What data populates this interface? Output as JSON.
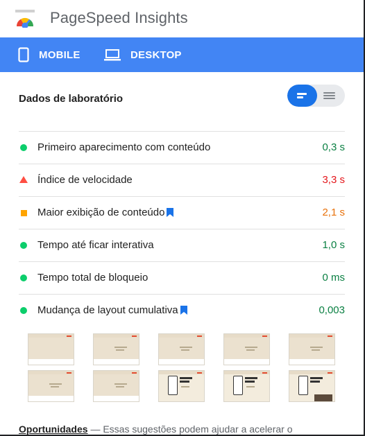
{
  "header": {
    "title": "PageSpeed Insights",
    "logo_icon": "pagespeed-gauge-icon"
  },
  "tabs": [
    {
      "label": "MOBILE",
      "icon": "smartphone-icon"
    },
    {
      "label": "DESKTOP",
      "icon": "laptop-icon"
    }
  ],
  "lab": {
    "title": "Dados de laboratório",
    "metrics": [
      {
        "label": "Primeiro aparecimento com conteúdo",
        "value": "0,3 s",
        "status": "good",
        "bookmark": false
      },
      {
        "label": "Índice de velocidade",
        "value": "3,3 s",
        "status": "poor",
        "bookmark": false
      },
      {
        "label": "Maior exibição de conteúdo",
        "value": "2,1 s",
        "status": "average",
        "bookmark": true
      },
      {
        "label": "Tempo até ficar interativa",
        "value": "1,0 s",
        "status": "good",
        "bookmark": false
      },
      {
        "label": "Tempo total de bloqueio",
        "value": "0 ms",
        "status": "good",
        "bookmark": false
      },
      {
        "label": "Mudança de layout cumulativa",
        "value": "0,003",
        "status": "good",
        "bookmark": true
      }
    ]
  },
  "opportunities": {
    "title": "Oportunidades",
    "description": " — Essas sugestões podem ajudar a acelerar o"
  },
  "colors": {
    "accent": "#4285f4",
    "good": "#0b8043",
    "poor": "#e4161b",
    "average": "#e8710a"
  }
}
